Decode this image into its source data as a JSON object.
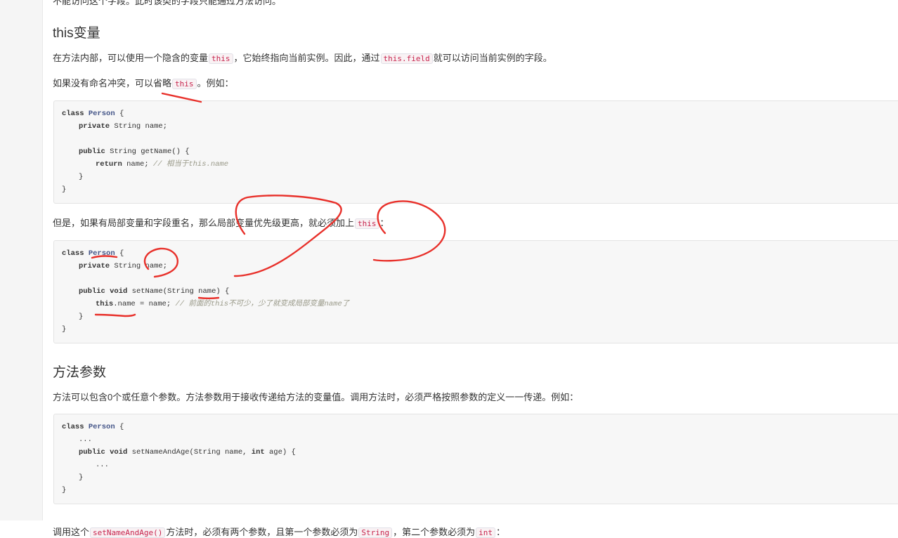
{
  "top_partial": {
    "text": "不能访问这个字段。此时该类的字段只能通过方法访问。"
  },
  "section_this": {
    "heading": "this变量",
    "para1": {
      "before": "在方法内部，可以使用一个隐含的变量",
      "code1": "this",
      "middle": "，它始终指向当前实例。因此，通过",
      "code2": "this.field",
      "after": "就可以访问当前实例的字段。"
    },
    "para2": {
      "before": "如果没有命名冲突，可以省略",
      "code": "this",
      "after": "。例如："
    },
    "code1": {
      "l1": {
        "kw": "class",
        "name": "Person",
        "rest": " {"
      },
      "l2": {
        "kw": "private",
        "rest": " String name;"
      },
      "l4": {
        "kw": "public",
        "rest": " String getName() {"
      },
      "l5": {
        "kw": "return",
        "rest": " name; ",
        "comment": "// 相当于this.name"
      },
      "l6": "}",
      "l7": "}"
    },
    "para3": {
      "before": "但是，如果有局部变量和字段重名，那么局部变量优先级更高，就必须加上",
      "code": "this",
      "after": "："
    },
    "code2": {
      "l1": {
        "kw": "class",
        "name": "Person",
        "rest": " {"
      },
      "l2": {
        "kw": "private",
        "rest": " String name;"
      },
      "l4": {
        "kw1": "public",
        "kw2": "void",
        "rest": " setName(String name) {"
      },
      "l5": {
        "kw": "this",
        "rest": ".name = name; ",
        "comment": "// 前面的this不可少，少了就变成局部变量name了"
      },
      "l6": "}",
      "l7": "}"
    }
  },
  "section_params": {
    "heading": "方法参数",
    "para1": "方法可以包含0个或任意个参数。方法参数用于接收传递给方法的变量值。调用方法时，必须严格按照参数的定义一一传递。例如：",
    "code3": {
      "l1": {
        "kw": "class",
        "name": "Person",
        "rest": " {"
      },
      "l2": "...",
      "l3": {
        "kw1": "public",
        "kw2": "void",
        "rest1": " setNameAndAge(String name, ",
        "kw3": "int",
        "rest2": " age) {"
      },
      "l4": "...",
      "l5": "}",
      "l6": "}"
    },
    "bottom_partial": {
      "before": "调用这个",
      "code1": "setNameAndAge()",
      "middle": "方法时，必须有两个参数，且第一个参数必须为",
      "code2": "String",
      "middle2": "，第二个参数必须为",
      "code3": "int",
      "after": "："
    }
  },
  "annotation_color": "#e8302a"
}
